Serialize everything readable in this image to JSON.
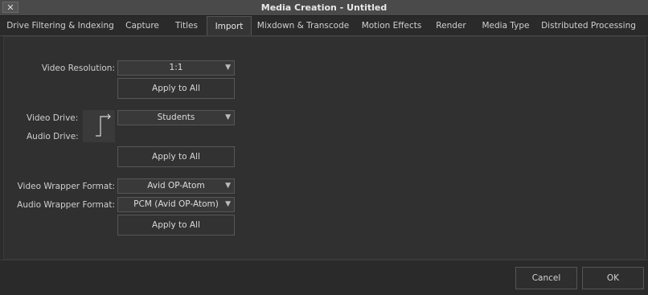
{
  "window": {
    "title": "Media Creation - Untitled",
    "close_glyph": "✕"
  },
  "tabs": [
    {
      "label": "Drive Filtering & Indexing"
    },
    {
      "label": "Capture"
    },
    {
      "label": "Titles"
    },
    {
      "label": "Import",
      "active": true
    },
    {
      "label": "Mixdown & Transcode"
    },
    {
      "label": "Motion Effects"
    },
    {
      "label": "Render"
    },
    {
      "label": "Media Type"
    },
    {
      "label": "Distributed Processing"
    }
  ],
  "import": {
    "video_resolution": {
      "label": "Video Resolution:",
      "value": "1:1",
      "apply_label": "Apply to All"
    },
    "drives": {
      "video_label": "Video Drive:",
      "audio_label": "Audio Drive:",
      "value": "Students",
      "link_icon": "drive-link-icon",
      "apply_label": "Apply to All"
    },
    "video_wrapper": {
      "label": "Video Wrapper Format:",
      "value": "Avid OP-Atom"
    },
    "audio_wrapper": {
      "label": "Audio Wrapper Format:",
      "value": "PCM (Avid OP-Atom)"
    },
    "wrapper_apply_label": "Apply to All",
    "dropdown_arrow": "▼"
  },
  "footer": {
    "cancel_label": "Cancel",
    "ok_label": "OK"
  },
  "colors": {
    "background": "#2c2c2c",
    "titlebar": "#4a4a4a",
    "text": "#cfcfcf"
  }
}
